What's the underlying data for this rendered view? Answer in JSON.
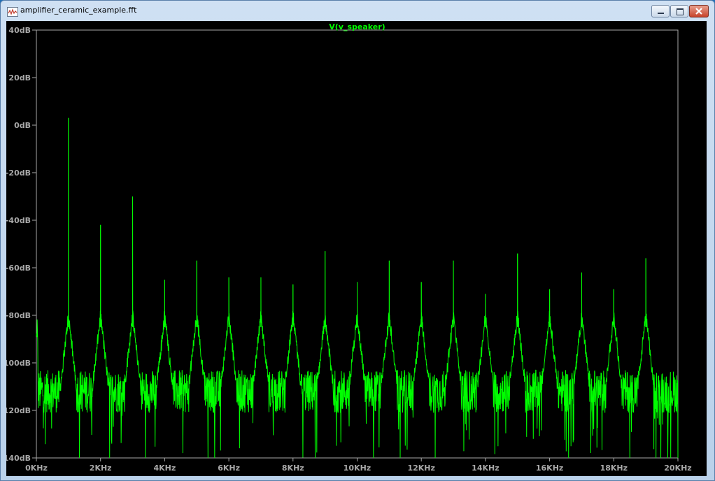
{
  "window": {
    "title": "amplifier_ceramic_example.fft",
    "icon": "waveform-plot-icon",
    "controls": [
      "minimize-icon",
      "maximize-icon",
      "close-icon"
    ]
  },
  "colors": {
    "plot_background": "#000000",
    "trace": "#00ff00",
    "axis": "#a9a9a9",
    "series_label": "#00ff00"
  },
  "chart_data": {
    "type": "line",
    "title": "V(v_speaker)",
    "xlabel": "",
    "ylabel": "",
    "xlim": [
      0,
      20
    ],
    "ylim": [
      -140,
      40
    ],
    "x_unit": "KHz",
    "y_unit": "dB",
    "grid": false,
    "xticks": [
      "0KHz",
      "2KHz",
      "4KHz",
      "6KHz",
      "8KHz",
      "10KHz",
      "12KHz",
      "14KHz",
      "16KHz",
      "18KHz",
      "20KHz"
    ],
    "yticks": [
      "40dB",
      "20dB",
      "0dB",
      "-20dB",
      "-40dB",
      "-60dB",
      "-80dB",
      "-100dB",
      "-120dB",
      "-140dB"
    ],
    "series": [
      {
        "name": "V(v_speaker)",
        "harmonic_peaks": {
          "x": [
            1,
            2,
            3,
            4,
            5,
            6,
            7,
            8,
            9,
            10,
            11,
            12,
            13,
            14,
            15,
            16,
            17,
            18,
            19
          ],
          "y": [
            3,
            -42,
            -30,
            -65,
            -57,
            -64,
            -64,
            -67,
            -53,
            -66,
            -57,
            -66,
            -57,
            -71,
            -54,
            -69,
            -62,
            -69,
            -56
          ]
        },
        "noise_floor_db": -112,
        "noise_floor_min_db": -140
      }
    ]
  }
}
